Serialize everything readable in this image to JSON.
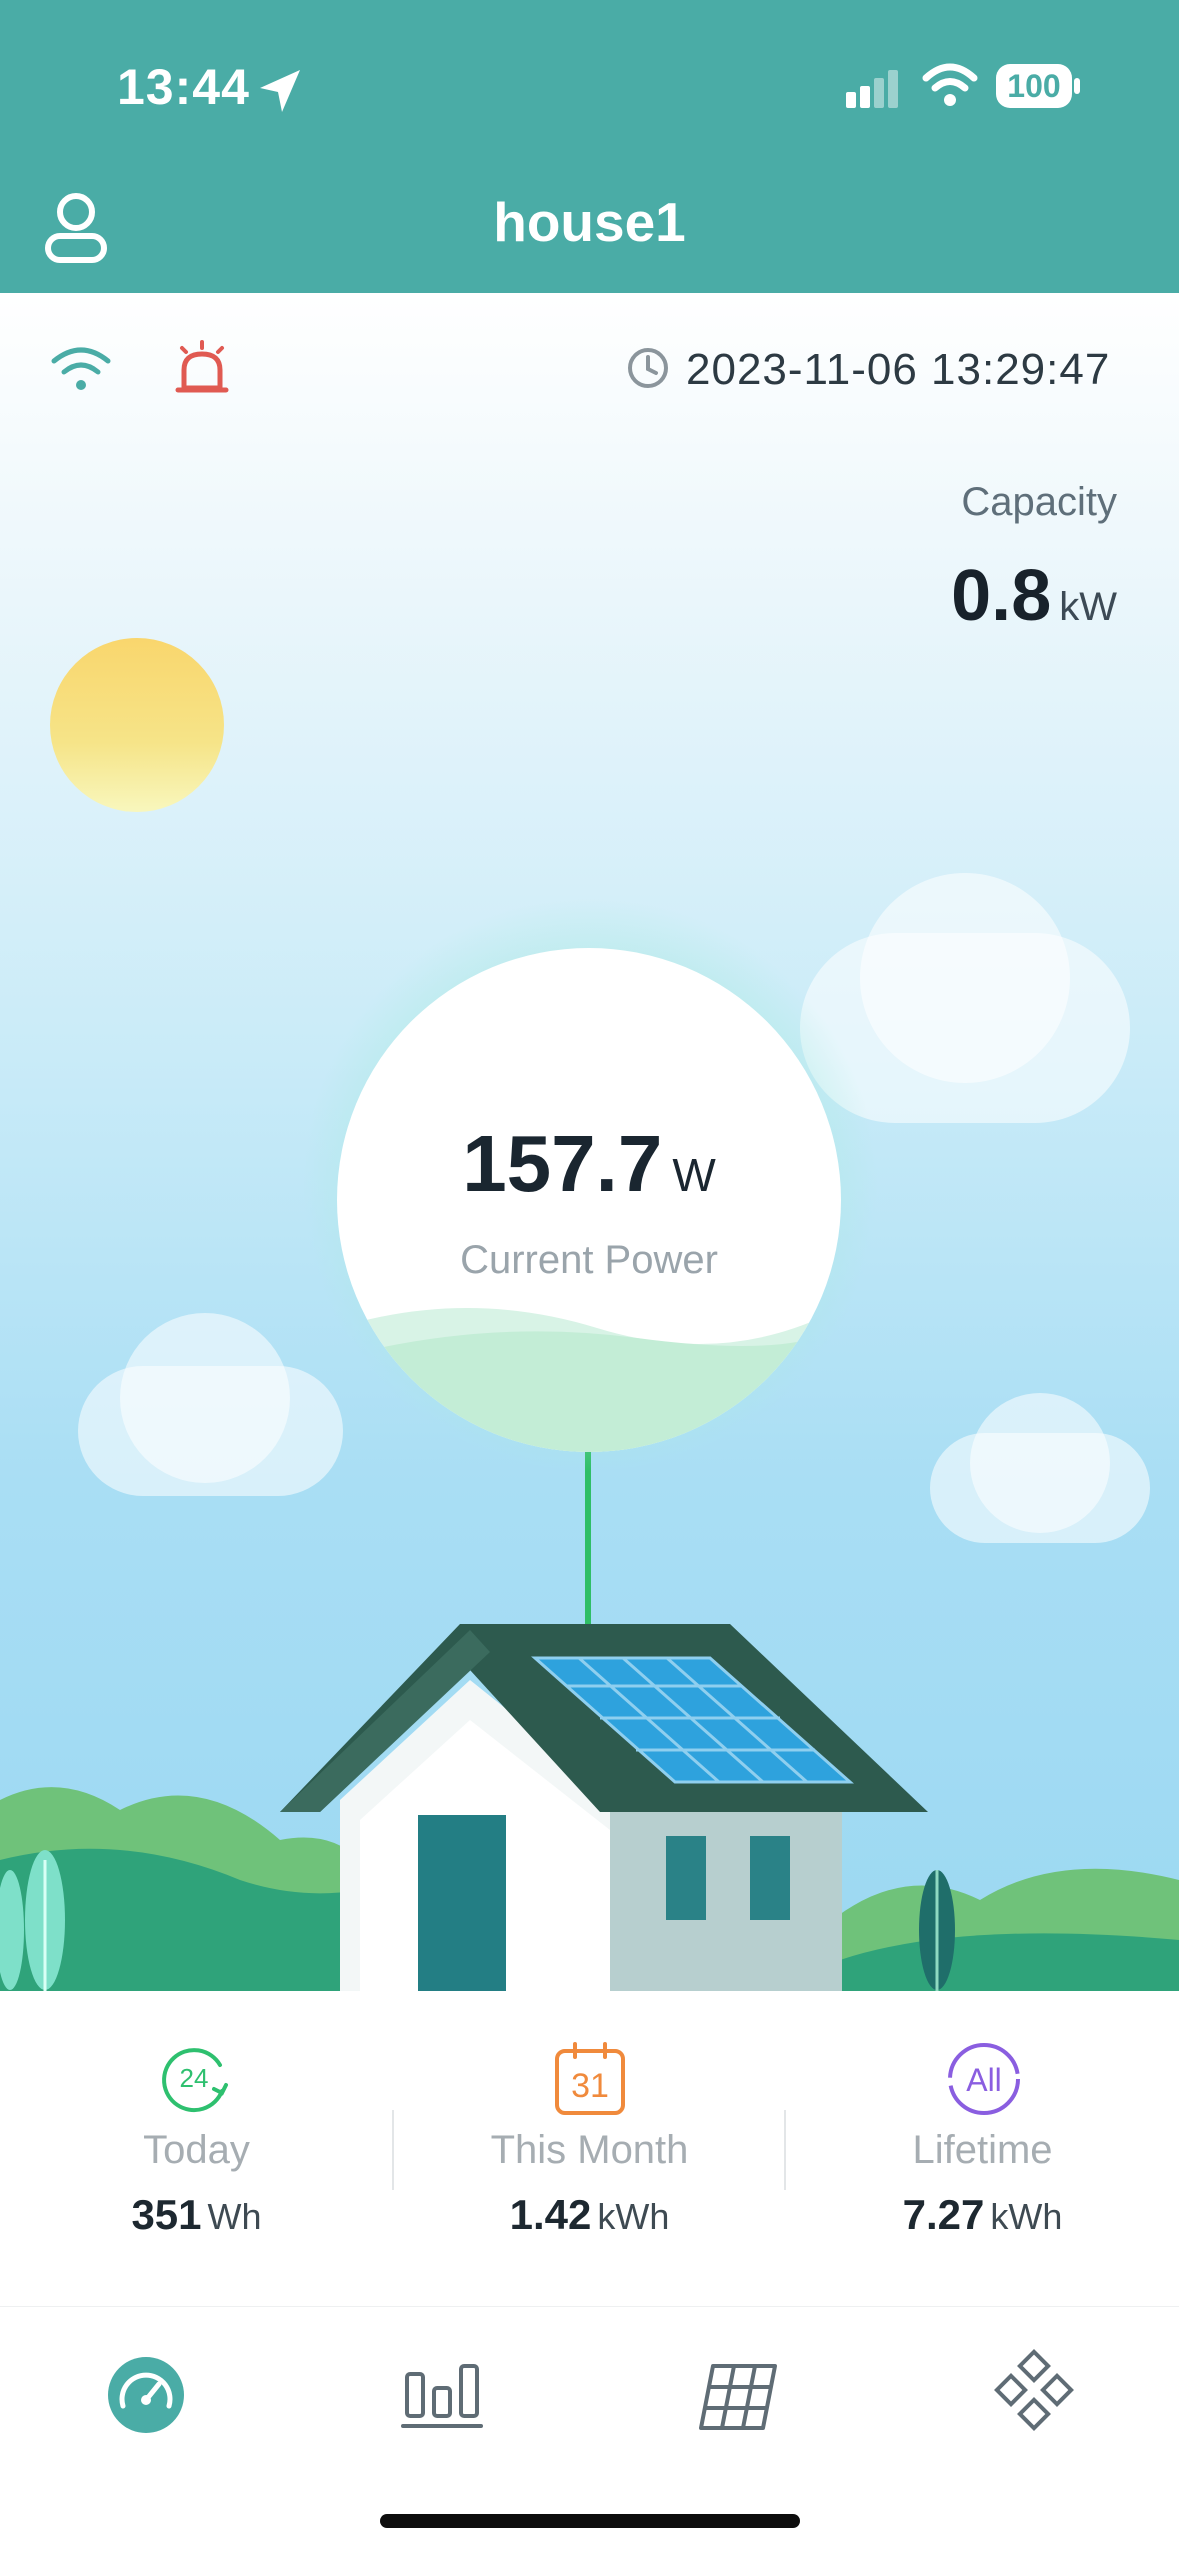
{
  "status_bar": {
    "time": "13:44",
    "battery": "100"
  },
  "header": {
    "title": "house1"
  },
  "dashboard": {
    "datetime": "2023-11-06 13:29:47",
    "capacity": {
      "label": "Capacity",
      "value": "0.8",
      "unit": "kW"
    },
    "current_power": {
      "value": "157.7",
      "unit": "W",
      "label": "Current Power"
    }
  },
  "stats": [
    {
      "icon_text": "24",
      "label": "Today",
      "value": "351",
      "unit": "Wh"
    },
    {
      "icon_text": "31",
      "label": "This Month",
      "value": "1.42",
      "unit": "kWh"
    },
    {
      "icon_text": "All",
      "label": "Lifetime",
      "value": "7.27",
      "unit": "kWh"
    }
  ],
  "tabbar": {
    "items": [
      "dashboard-icon",
      "chart-bars-icon",
      "solar-panel-icon",
      "grid-diamond-icon"
    ],
    "active_index": 0
  },
  "colors": {
    "header": "#4aaca6",
    "alarm": "#e05a52",
    "today_accent": "#2ec06f",
    "month_accent": "#f08a3c",
    "lifetime_accent": "#8a5ee0",
    "power_line": "#2fbe66"
  }
}
